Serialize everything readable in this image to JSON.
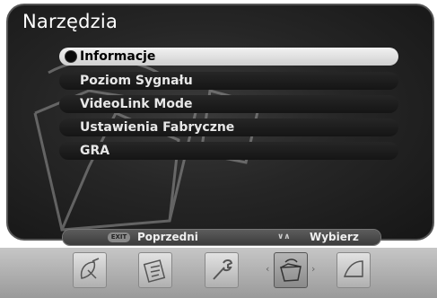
{
  "title": "Narzędzia",
  "menu": {
    "items": [
      {
        "label": "Informacje",
        "active": true
      },
      {
        "label": "Poziom Sygnału",
        "active": false
      },
      {
        "label": "VideoLink Mode",
        "active": false
      },
      {
        "label": "Ustawienia Fabryczne",
        "active": false
      },
      {
        "label": "GRA",
        "active": false
      }
    ]
  },
  "help": {
    "exit_key": "EXIT",
    "back_label": "Poprzedni",
    "nav_icon": "up-down-arrows-icon",
    "select_label": "Wybierz"
  },
  "toolbar": {
    "icons": [
      "satellite-dish-icon",
      "settings-icon",
      "wrench-icon",
      "toolbox-icon",
      "book-icon"
    ],
    "selected": "toolbox-icon"
  }
}
